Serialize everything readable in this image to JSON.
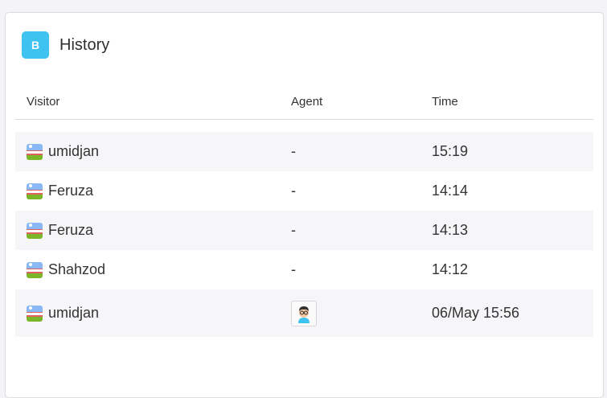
{
  "header": {
    "badge_letter": "B",
    "title": "History"
  },
  "table": {
    "columns": [
      "Visitor",
      "Agent",
      "Time"
    ],
    "rows": [
      {
        "visitor": "umidjan",
        "flag": "uzbekistan-flag-icon",
        "agent": "-",
        "time": "15:19"
      },
      {
        "visitor": "Feruza",
        "flag": "uzbekistan-flag-icon",
        "agent": "-",
        "time": "14:14"
      },
      {
        "visitor": "Feruza",
        "flag": "uzbekistan-flag-icon",
        "agent": "-",
        "time": "14:13"
      },
      {
        "visitor": "Shahzod",
        "flag": "uzbekistan-flag-icon",
        "agent": "-",
        "time": "14:12"
      },
      {
        "visitor": "umidjan",
        "flag": "uzbekistan-flag-icon",
        "agent": "agent-avatar-icon",
        "time": "06/May 15:56"
      }
    ]
  },
  "colors": {
    "badge": "#3ec3f0",
    "row_alt": "#f6f6f8",
    "divider": "#dcdcdf"
  }
}
